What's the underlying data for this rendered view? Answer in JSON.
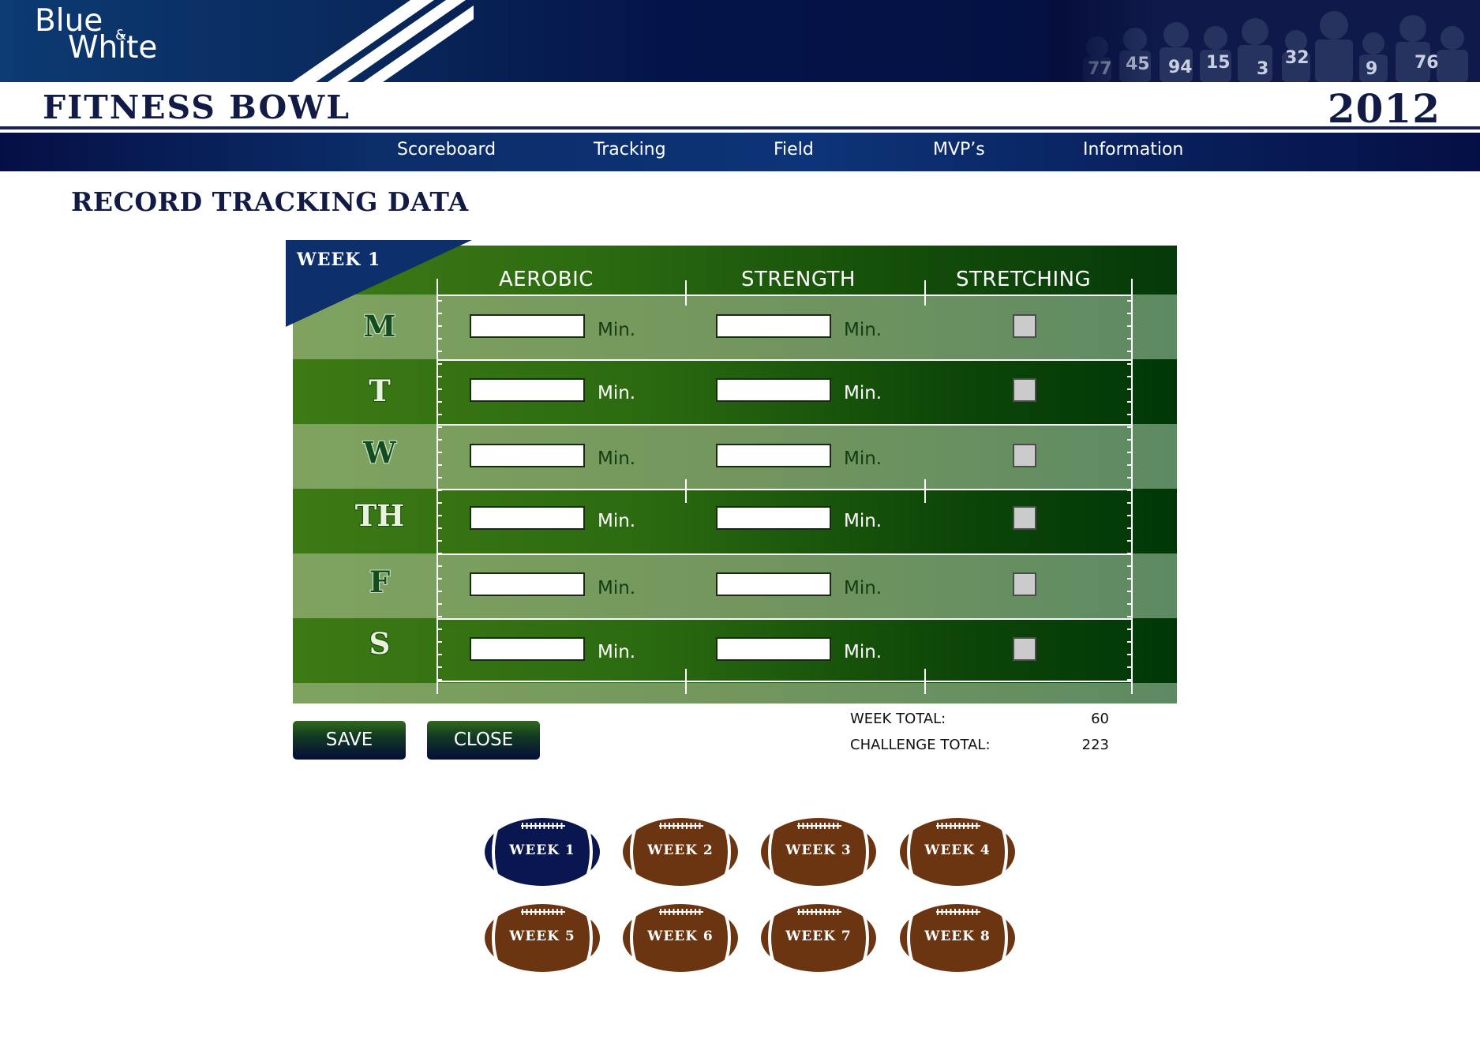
{
  "header": {
    "logo_line1": "Blue",
    "logo_amp": "&",
    "logo_line2": "White",
    "title": "FITNESS BOWL",
    "year": "2012"
  },
  "nav": {
    "items": [
      {
        "label": "Scoreboard"
      },
      {
        "label": "Tracking"
      },
      {
        "label": "Field"
      },
      {
        "label": "MVP’s"
      },
      {
        "label": "Information"
      }
    ]
  },
  "page_title": "RECORD TRACKING DATA",
  "tracker": {
    "week_label": "WEEK 1",
    "columns": {
      "aerobic": "AEROBIC",
      "strength": "STRENGTH",
      "stretching": "STRETCHING"
    },
    "unit_label": "Min.",
    "days": [
      {
        "label": "M",
        "aerobic": "",
        "strength": "",
        "stretching": false
      },
      {
        "label": "T",
        "aerobic": "",
        "strength": "",
        "stretching": false
      },
      {
        "label": "W",
        "aerobic": "",
        "strength": "",
        "stretching": false
      },
      {
        "label": "TH",
        "aerobic": "",
        "strength": "",
        "stretching": false
      },
      {
        "label": "F",
        "aerobic": "",
        "strength": "",
        "stretching": false
      },
      {
        "label": "S",
        "aerobic": "",
        "strength": "",
        "stretching": false
      }
    ]
  },
  "actions": {
    "save_label": "SAVE",
    "close_label": "CLOSE"
  },
  "totals": {
    "week_label": "WEEK TOTAL:",
    "week_value": "60",
    "challenge_label": "CHALLENGE TOTAL:",
    "challenge_value": "223"
  },
  "weeks": [
    {
      "label": "WEEK 1",
      "selected": true
    },
    {
      "label": "WEEK 2",
      "selected": false
    },
    {
      "label": "WEEK 3",
      "selected": false
    },
    {
      "label": "WEEK 4",
      "selected": false
    },
    {
      "label": "WEEK 5",
      "selected": false
    },
    {
      "label": "WEEK 6",
      "selected": false
    },
    {
      "label": "WEEK 7",
      "selected": false
    },
    {
      "label": "WEEK 8",
      "selected": false
    }
  ],
  "colors": {
    "navy": "#121b45",
    "field_light": "#7fa35f",
    "field_dark": "#0d4608",
    "ball_brown": "#6b3511",
    "ball_selected": "#0a1650"
  }
}
